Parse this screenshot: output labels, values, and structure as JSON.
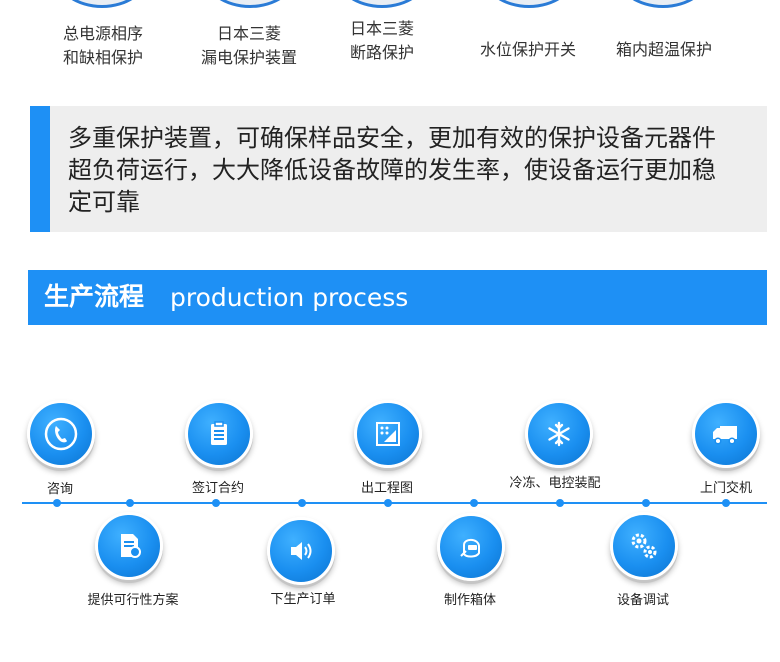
{
  "protection_items": [
    {
      "line1": "总电源相序",
      "line2": "和缺相保护"
    },
    {
      "line1": "日本三菱",
      "line2": "漏电保护装置"
    },
    {
      "line1": "日本三菱",
      "line2": "断路保护"
    },
    {
      "line1": "水位保护开关",
      "line2": ""
    },
    {
      "line1": "箱内超温保护",
      "line2": ""
    }
  ],
  "note": {
    "text": "多重保护装置，可确保样品安全，更加有效的保护设备元器件\n超负荷运行，大大降低设备故障的发生率，使设备运行更加稳\n定可靠"
  },
  "section": {
    "title_cn": "生产流程",
    "title_en": "production process"
  },
  "process_steps": [
    {
      "label": "咨询",
      "icon": "phone-icon"
    },
    {
      "label": "提供可行性方案",
      "icon": "document-icon"
    },
    {
      "label": "签订合约",
      "icon": "clipboard-icon"
    },
    {
      "label": "下生产订单",
      "icon": "speaker-icon"
    },
    {
      "label": "出工程图",
      "icon": "blueprint-icon"
    },
    {
      "label": "制作箱体",
      "icon": "welding-mask-icon"
    },
    {
      "label": "冷冻、电控装配",
      "icon": "snowflake-icon"
    },
    {
      "label": "设备调试",
      "icon": "gears-icon"
    },
    {
      "label": "上门交机",
      "icon": "truck-icon"
    }
  ],
  "colors": {
    "accent": "#1e90f5",
    "panel": "#eeeeee",
    "text": "#333333"
  }
}
